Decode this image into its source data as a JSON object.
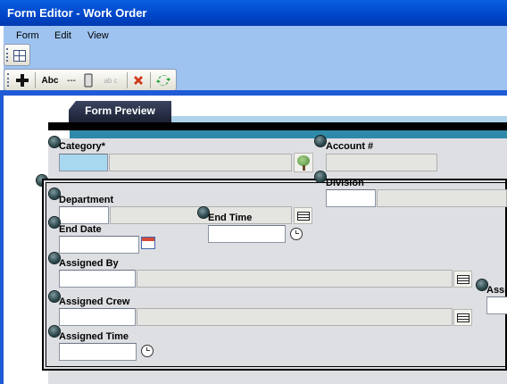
{
  "window": {
    "title": "Form Editor - Work Order"
  },
  "menu": {
    "items": [
      "Form",
      "Edit",
      "View"
    ]
  },
  "toolbar": {
    "abc_label": "Abc",
    "dash_label": "---",
    "disabled_abc_label": "ab c"
  },
  "tabs": {
    "preview": "Form Preview"
  },
  "form": {
    "category": {
      "label": "Category*"
    },
    "account": {
      "label": "Account #"
    },
    "division": {
      "label": "Division"
    },
    "department": {
      "label": "Department"
    },
    "end_time": {
      "label": "End Time"
    },
    "end_date": {
      "label": "End Date"
    },
    "assigned_by": {
      "label": "Assigned By"
    },
    "assigned_crew": {
      "label": "Assigned Crew"
    },
    "assigned_time": {
      "label": "Assigned Time"
    },
    "cut_label": "Assi"
  },
  "colors": {
    "titlebar": "#0045c8",
    "toolband": "#9ec3f0",
    "header_teal": "#2e8aa8",
    "category_highlight": "#a8d8f0"
  }
}
